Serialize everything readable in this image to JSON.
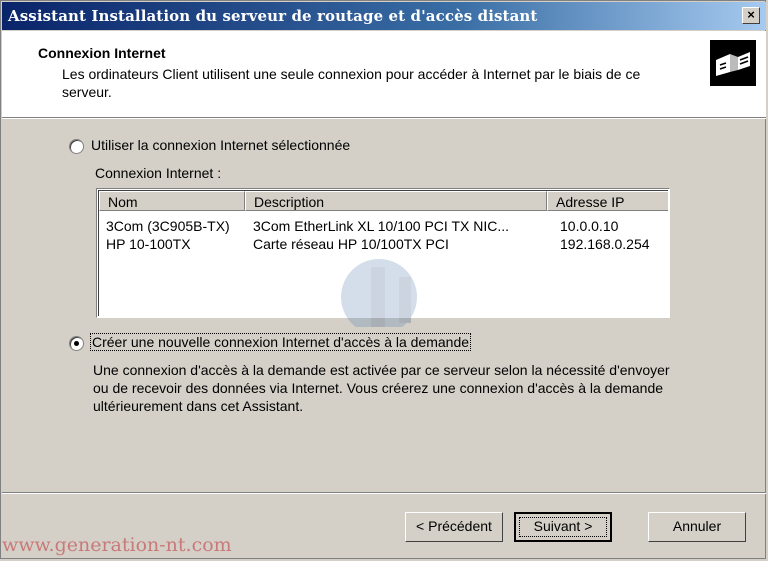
{
  "window": {
    "title": "Assistant Installation du serveur de routage et d'accès distant",
    "close": "×"
  },
  "header": {
    "title": "Connexion Internet",
    "description": "Les ordinateurs Client utilisent une seule connexion pour accéder à Internet par le biais de ce serveur."
  },
  "option_existing": {
    "label": "Utiliser la connexion Internet sélectionnée",
    "checked": false
  },
  "list_label": "Connexion Internet :",
  "list": {
    "columns": [
      "Nom",
      "Description",
      "Adresse IP"
    ],
    "rows": [
      [
        "3Com (3C905B-TX)",
        "3Com EtherLink XL 10/100 PCI TX NIC...",
        "10.0.0.10"
      ],
      [
        "HP 10-100TX",
        "Carte réseau HP 10/100TX PCI",
        "192.168.0.254"
      ]
    ]
  },
  "option_new": {
    "label": "Créer une nouvelle connexion Internet d'accès à la demande",
    "checked": true
  },
  "option_new_desc": "Une connexion d'accès à la demande est activée par ce serveur selon la nécessité d'envoyer ou de recevoir des données via Internet. Vous créerez une connexion d'accès à la demande ultérieurement dans cet Assistant.",
  "buttons": {
    "back": "< Précédent",
    "next": "Suivant >",
    "cancel": "Annuler"
  },
  "watermark": "www.generation-nt.com",
  "colors": {
    "title_bar": "#0a246a",
    "dialog_bg": "#d4d0c8",
    "watermark": "#c87a7a"
  }
}
